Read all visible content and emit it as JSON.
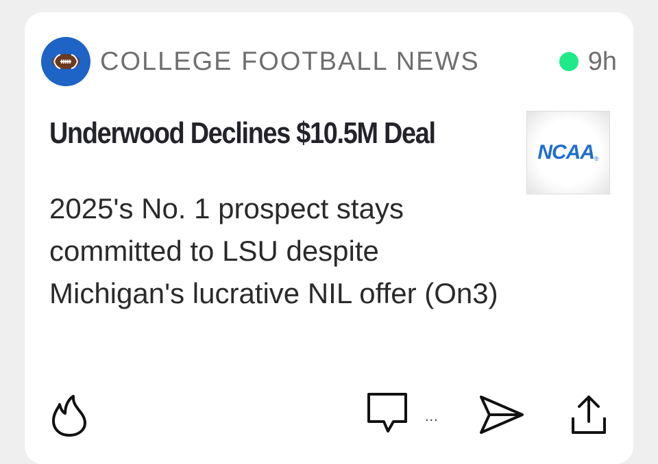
{
  "source": {
    "name": "COLLEGE FOOTBALL NEWS",
    "logo_icon": "football-icon",
    "logo_color": "#1e63c6"
  },
  "status": {
    "live_color": "#1eea8a",
    "time_ago": "9h"
  },
  "article": {
    "headline": "Underwood Declines $10.5M Deal",
    "summary": "2025's No. 1 prospect stays committed to LSU despite Michigan's lucrative NIL offer (On3)",
    "thumbnail": {
      "logo_text": "NCAA",
      "logo_mark": "®",
      "brand_color": "#1f6ed0"
    }
  },
  "actions": {
    "react_icon": "fire-icon",
    "comment_icon": "comment-icon",
    "comment_count": "...",
    "send_icon": "send-icon",
    "share_icon": "share-icon"
  }
}
